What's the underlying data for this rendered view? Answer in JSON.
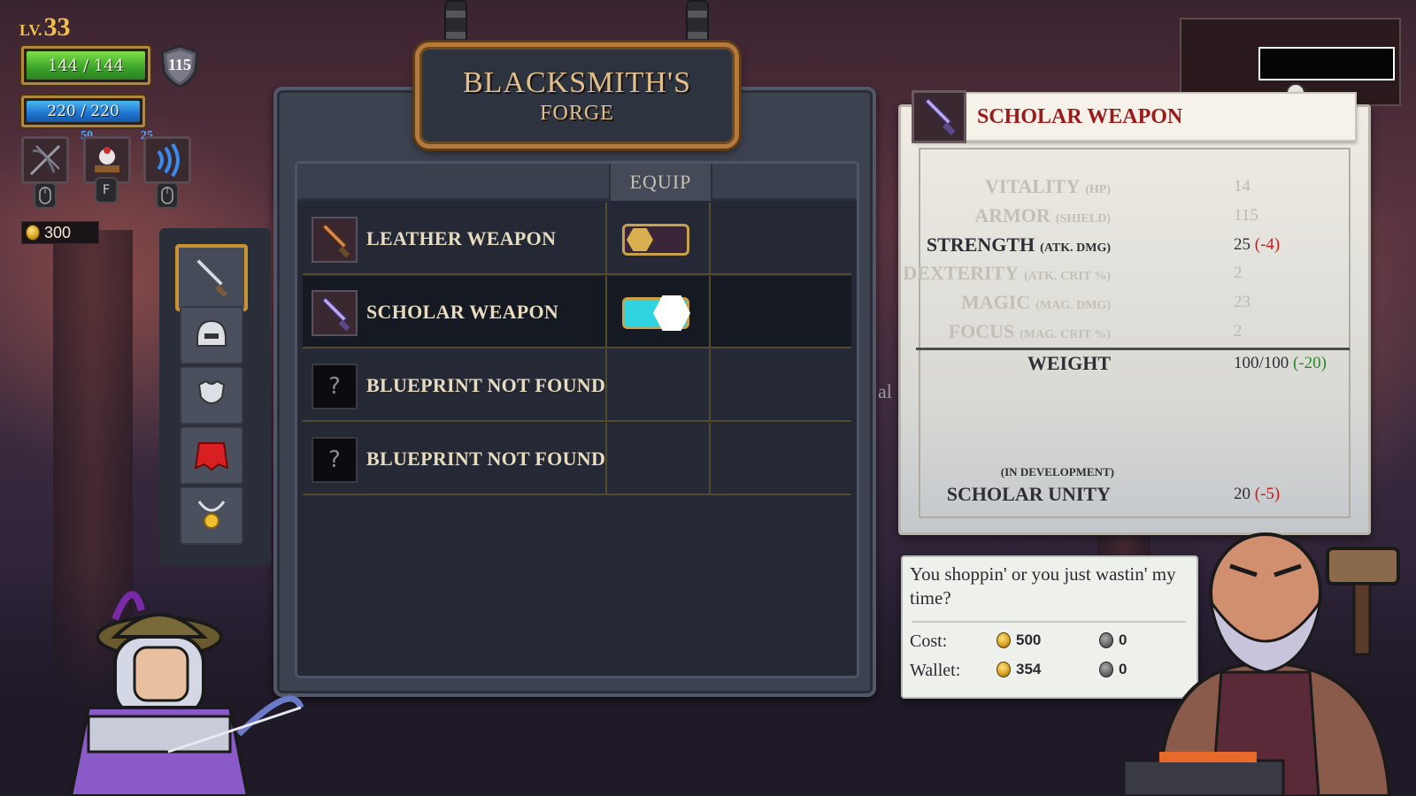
{
  "hud": {
    "level_prefix": "LV.",
    "level": "33",
    "hp": "144 / 144",
    "mp": "220 / 220",
    "armor": "115",
    "gold": "300",
    "skills": [
      {
        "icon": "crossbow-icon",
        "count": ""
      },
      {
        "icon": "companion-icon",
        "count": "50",
        "key": "F"
      },
      {
        "icon": "sound-wave-icon",
        "count": "25"
      }
    ]
  },
  "forge": {
    "title_line1": "BLACKSMITH'S",
    "title_line2": "FORGE",
    "equip_header": "EQUIP",
    "items": [
      {
        "name": "LEATHER WEAPON",
        "equipped": false
      },
      {
        "name": "SCHOLAR WEAPON",
        "equipped": true,
        "selected": true
      },
      {
        "name": "BLUEPRINT NOT FOUND",
        "unknown": "?"
      },
      {
        "name": "BLUEPRINT NOT FOUND",
        "unknown": "?"
      }
    ],
    "categories": [
      "sword-icon",
      "helmet-icon",
      "chest-armor-icon",
      "cape-icon",
      "amulet-icon"
    ]
  },
  "details": {
    "title": "SCHOLAR WEAPON",
    "stats": [
      {
        "name": "VITALITY",
        "sub": "(HP)",
        "value": "14",
        "delta": ""
      },
      {
        "name": "ARMOR",
        "sub": "(SHIELD)",
        "value": "115",
        "delta": ""
      },
      {
        "name": "STRENGTH",
        "sub": "(ATK. DMG)",
        "value": "25",
        "delta": "(-4)"
      },
      {
        "name": "DEXTERITY",
        "sub": "(ATK. CRIT %)",
        "value": "2",
        "delta": ""
      },
      {
        "name": "MAGIC",
        "sub": "(MAG. DMG)",
        "value": "23",
        "delta": ""
      },
      {
        "name": "FOCUS",
        "sub": "(MAG. CRIT %)",
        "value": "2",
        "delta": ""
      }
    ],
    "weight": {
      "name": "WEIGHT",
      "value": "100/100",
      "delta": "(-20)"
    },
    "in_development": "(IN DEVELOPMENT)",
    "unity": {
      "name": "SCHOLAR UNITY",
      "value": "20",
      "delta": "(-5)"
    }
  },
  "dialog": {
    "quote": "You shoppin' or you just wastin' my time?",
    "cost_label": "Cost:",
    "wallet_label": "Wallet:",
    "cost_gold": "500",
    "cost_ore": "0",
    "wallet_gold": "354",
    "wallet_ore": "0"
  },
  "background_text": "al",
  "colors": {
    "negative": "#c81a1a",
    "positive": "#2a8a2a",
    "title_red": "#9a1a1a",
    "gold": "#f0c04a"
  }
}
